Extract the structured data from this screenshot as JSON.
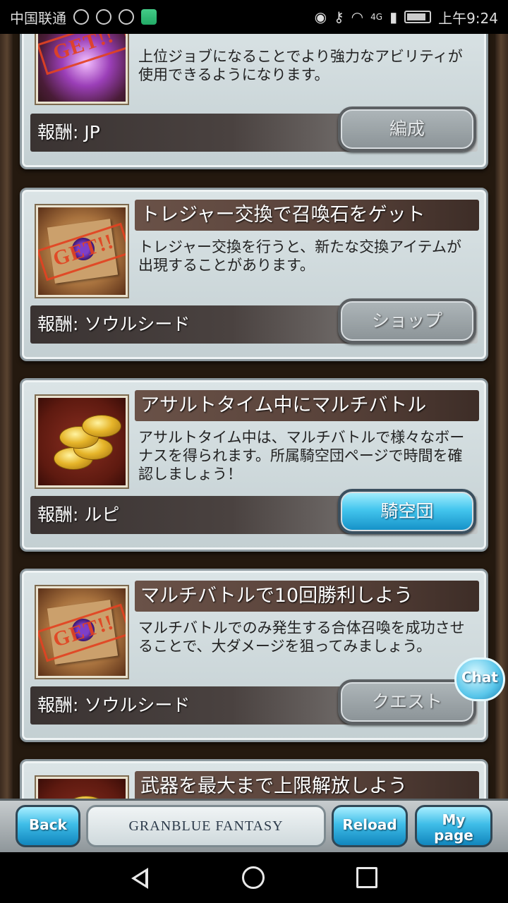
{
  "status_bar": {
    "carrier": "中国联通",
    "time": "上午9:24",
    "network": "4G"
  },
  "missions": [
    {
      "title": "",
      "description": "上位ジョブになることでより強力なアビリティが使用できるようになります。",
      "reward": "報酬: JP",
      "button": "編成",
      "stamp": "GET!!"
    },
    {
      "title": "トレジャー交換で召喚石をゲット",
      "description": "トレジャー交換を行うと、新たな交換アイテムが出現することがあります。",
      "reward": "報酬: ソウルシード",
      "button": "ショップ",
      "stamp": "GET!!"
    },
    {
      "title": "アサルトタイム中にマルチバトル",
      "description": "アサルトタイム中は、マルチバトルで様々なボーナスを得られます。所属騎空団ページで時間を確認しましょう！",
      "reward": "報酬: ルピ",
      "button": "騎空団"
    },
    {
      "title": "マルチバトルで10回勝利しよう",
      "description": "マルチバトルでのみ発生する合体召喚を成功させることで、大ダメージを狙ってみましょう。",
      "reward": "報酬: ソウルシード",
      "button": "クエスト",
      "stamp": "GET!!"
    },
    {
      "title": "武器を最大まで上限解放しよう"
    }
  ],
  "chat": {
    "label": "Chat"
  },
  "nav": {
    "back": "Back",
    "logo": "GRANBLUE FANTASY",
    "reload": "Reload",
    "mypage_line1": "My",
    "mypage_line2": "page"
  },
  "colors": {
    "active_button": "#44c6ee",
    "title_bar": "#574139",
    "stamp": "#e24222"
  }
}
